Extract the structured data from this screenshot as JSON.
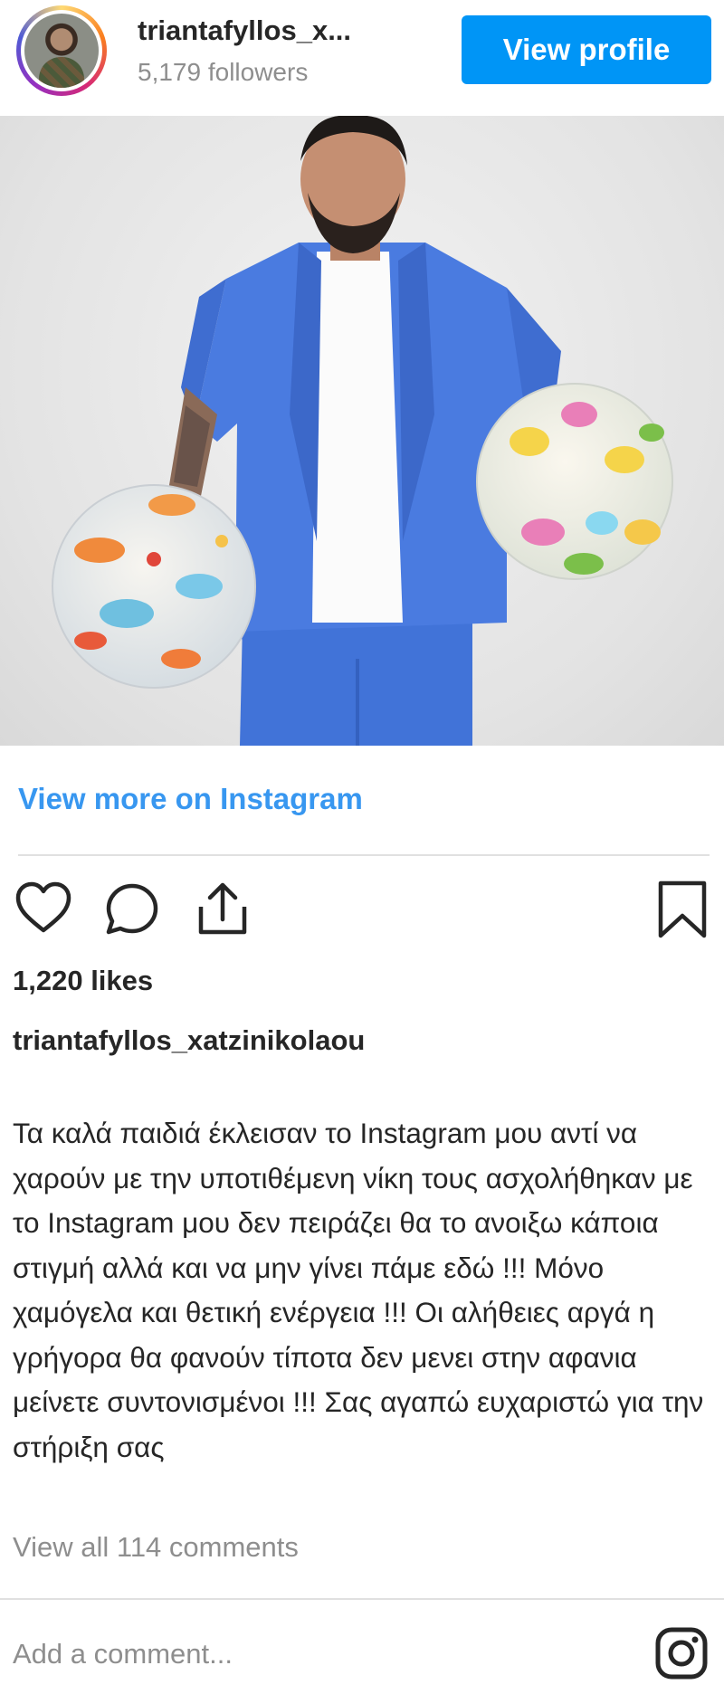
{
  "header": {
    "username": "triantafyllos_x...",
    "followers": "5,179 followers",
    "view_profile_label": "View profile",
    "avatar_icon": "profile-avatar"
  },
  "post": {
    "image_icon": "post-photo",
    "view_more_label": "View more on Instagram",
    "actions": {
      "like_icon": "heart-icon",
      "comment_icon": "comment-icon",
      "share_icon": "share-icon",
      "save_icon": "bookmark-icon"
    },
    "likes": "1,220 likes",
    "caption_username": "triantafyllos_xatzinikolaou",
    "caption_text": "Τα καλά παιδιά έκλεισαν το Instagram μου αντί να χαρούν με την υποτιθέμενη νίκη τους ασχολήθηκαν με το Instagram μου δεν πειράζει θα το ανοιξω κάποια στιγμή αλλά και να μην γίνει πάμε εδώ !!! Μόνο χαμόγελα και θετική ενέργεια !!! Οι αλήθειες αργά η γρήγορα θα φανούν τίποτα δεν μενει στην αφανια μείνετε συντονισμένοι !!! Σας αγαπώ ευχαριστώ για την στήριξη σας",
    "view_comments_label": "View all 114 comments"
  },
  "comment_box": {
    "placeholder": "Add a comment...",
    "logo_icon": "instagram-icon"
  },
  "colors": {
    "accent": "#0095f6",
    "link": "#3897f0",
    "muted": "#8e8e8e",
    "text": "#262626"
  }
}
